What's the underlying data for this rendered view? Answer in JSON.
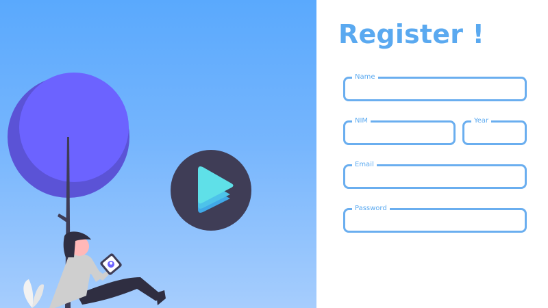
{
  "hero": {
    "illustration_icon": "person-under-tree-with-tablet",
    "play_icon": "play-icon",
    "colors": {
      "sky_top": "#5aa9fd",
      "sky_bottom": "#a6cdfd",
      "tree": "#6c63ff",
      "play_circle": "#3f3d56",
      "play_triangle": "#5fe0e8"
    }
  },
  "form": {
    "title": "Register !",
    "accent_color": "#5aa9f0",
    "fields": {
      "name": {
        "label": "Name",
        "value": ""
      },
      "nim": {
        "label": "NIM",
        "value": ""
      },
      "year": {
        "label": "Year",
        "value": ""
      },
      "email": {
        "label": "Email",
        "value": ""
      },
      "password": {
        "label": "Password",
        "value": ""
      }
    }
  }
}
